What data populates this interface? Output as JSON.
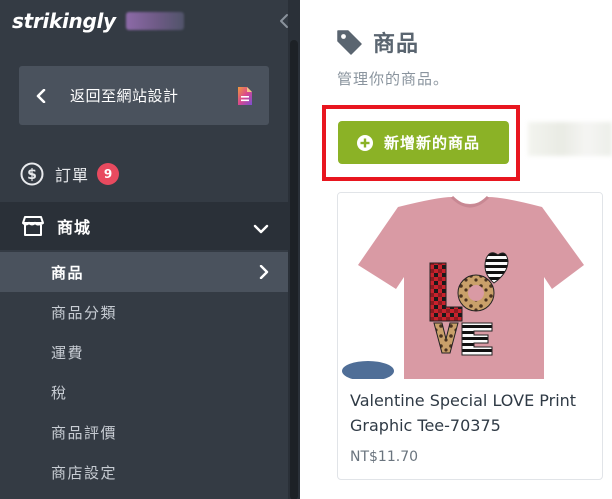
{
  "sidebar": {
    "brand": "strikingly",
    "back_label": "返回至網站設計",
    "orders": {
      "label": "訂單",
      "count": "9"
    },
    "store": {
      "label": "商城"
    },
    "items": [
      {
        "label": "商品",
        "active": true
      },
      {
        "label": "商品分類"
      },
      {
        "label": "運費"
      },
      {
        "label": "稅"
      },
      {
        "label": "商品評價"
      },
      {
        "label": "商店設定"
      }
    ]
  },
  "main": {
    "title": "商品",
    "subtitle": "管理你的商品。",
    "add_button": "新增新的商品",
    "product": {
      "name": "Valentine Special LOVE Print Graphic Tee-70375",
      "price": "NT$11.70"
    }
  },
  "colors": {
    "sidebar_bg": "#343b44",
    "active_item": "#4a525d",
    "accent_green": "#8bb226",
    "badge_red": "#e84a5f",
    "highlight_red": "#e8161f"
  },
  "icons": {
    "collapse": "chevron-left-icon",
    "back": "chevron-left-icon",
    "document": "document-icon",
    "orders": "dollar-circle-icon",
    "store": "storefront-icon",
    "store_caret": "chevron-down-icon",
    "active_arrow": "chevron-right-icon",
    "tag": "tag-icon",
    "add": "plus-circle-icon"
  }
}
